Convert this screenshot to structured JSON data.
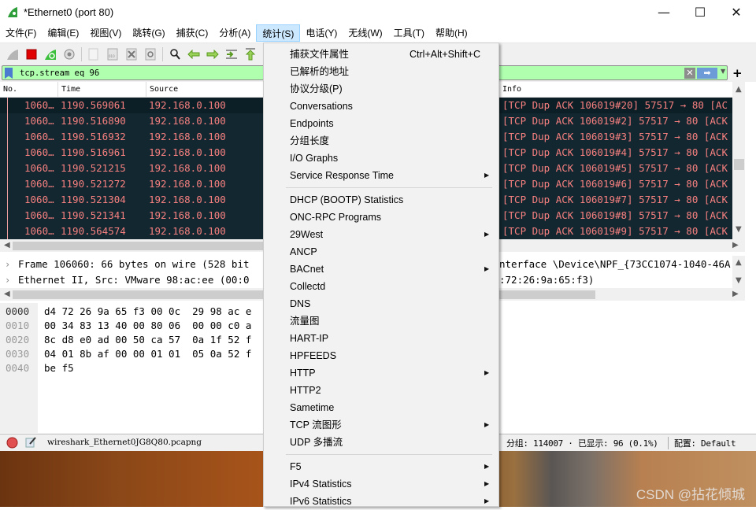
{
  "window": {
    "title": "*Ethernet0 (port 80)",
    "controls": {
      "minimize": "—",
      "maximize": "☐",
      "close": "✕"
    }
  },
  "menubar": {
    "items": [
      {
        "label": "文件(F)"
      },
      {
        "label": "编辑(E)"
      },
      {
        "label": "视图(V)"
      },
      {
        "label": "跳转(G)"
      },
      {
        "label": "捕获(C)"
      },
      {
        "label": "分析(A)"
      },
      {
        "label": "统计(S)",
        "active": true
      },
      {
        "label": "电话(Y)"
      },
      {
        "label": "无线(W)"
      },
      {
        "label": "工具(T)"
      },
      {
        "label": "帮助(H)"
      }
    ]
  },
  "toolbar": {
    "icons": [
      "start-capture-icon",
      "stop-capture-icon",
      "restart-capture-icon",
      "capture-options-icon",
      "open-file-icon",
      "save-file-icon",
      "close-file-icon",
      "reload-file-icon",
      "find-packet-icon",
      "go-back-icon",
      "go-forward-icon",
      "go-to-packet-icon",
      "go-first-icon",
      "go-last-icon"
    ]
  },
  "filter": {
    "value": "tcp.stream eq 96",
    "clear_glyph": "✕",
    "apply_glyph": "➡",
    "dropdown_glyph": "▼",
    "add_glyph": "+"
  },
  "packet_list": {
    "columns": {
      "no": "No.",
      "time": "Time",
      "source": "Source",
      "info": "Info"
    },
    "rows": [
      {
        "no": "1060…",
        "time": "1190.569061",
        "source": "192.168.0.100",
        "info": "[TCP Dup ACK 106019#20] 57517 → 80 [AC"
      },
      {
        "no": "1060…",
        "time": "1190.516890",
        "source": "192.168.0.100",
        "info": "[TCP Dup ACK 106019#2] 57517 → 80 [ACK"
      },
      {
        "no": "1060…",
        "time": "1190.516932",
        "source": "192.168.0.100",
        "info": "[TCP Dup ACK 106019#3] 57517 → 80 [ACK"
      },
      {
        "no": "1060…",
        "time": "1190.516961",
        "source": "192.168.0.100",
        "info": "[TCP Dup ACK 106019#4] 57517 → 80 [ACK"
      },
      {
        "no": "1060…",
        "time": "1190.521215",
        "source": "192.168.0.100",
        "info": "[TCP Dup ACK 106019#5] 57517 → 80 [ACK"
      },
      {
        "no": "1060…",
        "time": "1190.521272",
        "source": "192.168.0.100",
        "info": "[TCP Dup ACK 106019#6] 57517 → 80 [ACK"
      },
      {
        "no": "1060…",
        "time": "1190.521304",
        "source": "192.168.0.100",
        "info": "[TCP Dup ACK 106019#7] 57517 → 80 [ACK"
      },
      {
        "no": "1060…",
        "time": "1190.521341",
        "source": "192.168.0.100",
        "info": "[TCP Dup ACK 106019#8] 57517 → 80 [ACK"
      },
      {
        "no": "1060…",
        "time": "1190.564574",
        "source": "192.168.0.100",
        "info": "[TCP Dup ACK 106019#9] 57517 → 80 [ACK"
      }
    ]
  },
  "details": {
    "rows": [
      {
        "left": "Frame 106060: 66 bytes on wire (528 bit",
        "right": "nterface \\Device\\NPF_{73CC1074-1040-46A"
      },
      {
        "left": "Ethernet II, Src: VMware 98:ac:ee (00:0",
        "right": ":72:26:9a:65:f3)"
      }
    ]
  },
  "bytes": {
    "rows": [
      {
        "offset": "0000",
        "hex": "d4 72 26 9a 65 f3 00 0c  29 98 ac e"
      },
      {
        "offset": "0010",
        "hex": "00 34 83 13 40 00 80 06  00 00 c0 a"
      },
      {
        "offset": "0020",
        "hex": "8c d8 e0 ad 00 50 ca 57  0a 1f 52 f"
      },
      {
        "offset": "0030",
        "hex": "04 01 8b af 00 00 01 01  05 0a 52 f"
      },
      {
        "offset": "0040",
        "hex": "be f5"
      }
    ]
  },
  "statusbar": {
    "filename": "wireshark_Ethernet0JG8Q80.pcapng",
    "packets": "分组: 114007 · 已显示: 96 (0.1%)",
    "profile": "配置: Default"
  },
  "stats_menu": {
    "items": [
      {
        "label": "捕获文件属性",
        "shortcut": "Ctrl+Alt+Shift+C"
      },
      {
        "label": "已解析的地址"
      },
      {
        "label": "协议分级(P)"
      },
      {
        "label": "Conversations"
      },
      {
        "label": "Endpoints"
      },
      {
        "label": "分组长度"
      },
      {
        "label": "I/O Graphs"
      },
      {
        "label": "Service Response Time",
        "submenu": true
      },
      {
        "separator": true
      },
      {
        "label": "DHCP (BOOTP) Statistics"
      },
      {
        "label": "ONC-RPC Programs"
      },
      {
        "label": "29West",
        "submenu": true
      },
      {
        "label": "ANCP"
      },
      {
        "label": "BACnet",
        "submenu": true
      },
      {
        "label": "Collectd"
      },
      {
        "label": "DNS"
      },
      {
        "label": "流量图"
      },
      {
        "label": "HART-IP"
      },
      {
        "label": "HPFEEDS"
      },
      {
        "label": "HTTP",
        "submenu": true
      },
      {
        "label": "HTTP2"
      },
      {
        "label": "Sametime"
      },
      {
        "label": "TCP 流图形",
        "submenu": true
      },
      {
        "label": "UDP 多播流"
      },
      {
        "separator": true
      },
      {
        "label": "F5",
        "submenu": true
      },
      {
        "label": "IPv4 Statistics",
        "submenu": true
      },
      {
        "label": "IPv6 Statistics",
        "submenu": true
      }
    ],
    "submenu_glyph": "▶"
  },
  "watermark": "CSDN @拈花倾城",
  "colors": {
    "filter_ok": "#afffaf",
    "row_bg": "#12272f",
    "row_fg": "#f78080",
    "menu_highlight": "#cce8ff"
  }
}
